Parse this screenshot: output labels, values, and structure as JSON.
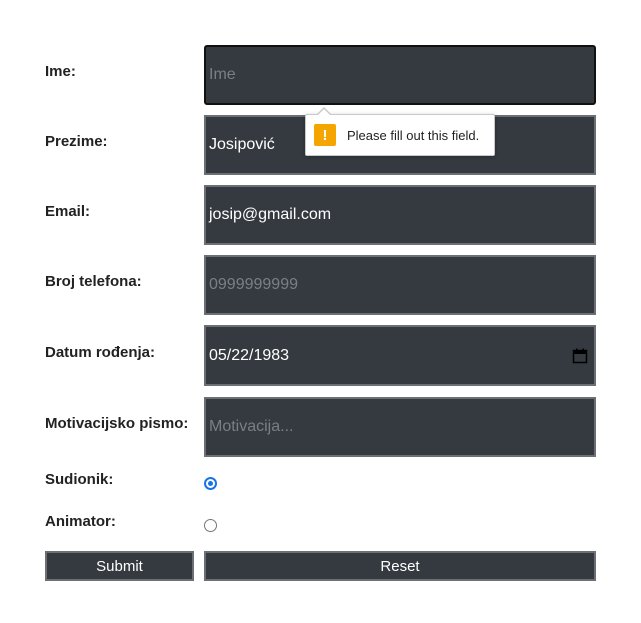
{
  "form": {
    "ime": {
      "label": "Ime:",
      "placeholder": "Ime",
      "value": ""
    },
    "prezime": {
      "label": "Prezime:",
      "value": "Josipović"
    },
    "email": {
      "label": "Email:",
      "value": "josip@gmail.com"
    },
    "telefon": {
      "label": "Broj telefona:",
      "placeholder": "0999999999",
      "value": ""
    },
    "datum": {
      "label": "Datum rođenja:",
      "value": "05/22/1983"
    },
    "motivacija": {
      "label": "Motivacijsko pismo:",
      "placeholder": "Motivacija...",
      "value": ""
    },
    "sudionik": {
      "label": "Sudionik:",
      "checked": true
    },
    "animator": {
      "label": "Animator:",
      "checked": false
    },
    "submit_label": "Submit",
    "reset_label": "Reset"
  },
  "validation": {
    "message": "Please fill out this field.",
    "icon": "!"
  },
  "colors": {
    "field_bg": "#343a40",
    "warning": "#f5a500",
    "radio_accent": "#1a73e8"
  }
}
